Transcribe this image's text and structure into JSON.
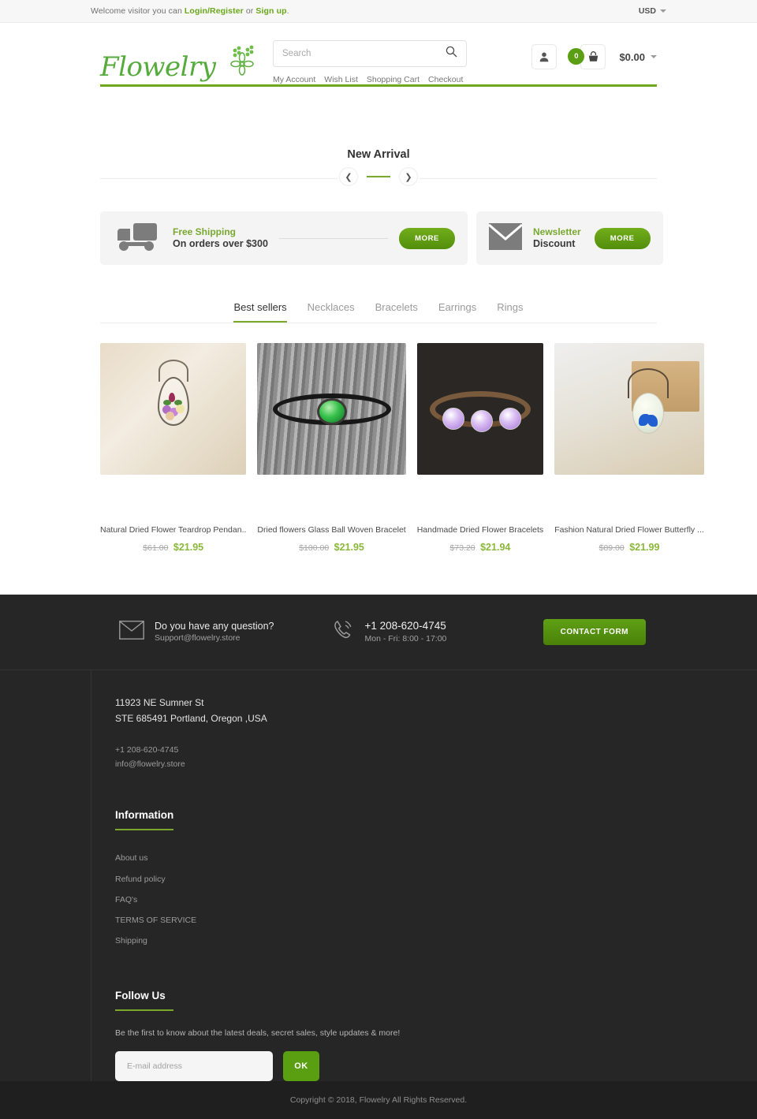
{
  "topbar": {
    "welcome_prefix": "Welcome visitor you can ",
    "login_label": "Login/Register",
    "or_label": " or ",
    "signup_label": "Sign up",
    "period": ".",
    "currency": "USD"
  },
  "header": {
    "logo_text": "Flowelry",
    "search_placeholder": "Search",
    "search_value": "",
    "links": [
      {
        "label": "My Account"
      },
      {
        "label": "Wish List"
      },
      {
        "label": "Shopping Cart"
      },
      {
        "label": "Checkout"
      }
    ],
    "cart_count": "0",
    "cart_total": "$0.00"
  },
  "new_arrival": {
    "title": "New Arrival",
    "prev_icon": "chevron-left-icon",
    "next_icon": "chevron-right-icon"
  },
  "promos": [
    {
      "icon": "truck-icon",
      "title": "Free Shipping",
      "subtitle": "On orders over $300",
      "button": "MORE"
    },
    {
      "icon": "envelope-icon",
      "title": "Newsletter",
      "subtitle": "Discount",
      "button": "MORE"
    }
  ],
  "tabs": [
    {
      "label": "Best sellers",
      "active": true
    },
    {
      "label": "Necklaces",
      "active": false
    },
    {
      "label": "Bracelets",
      "active": false
    },
    {
      "label": "Earrings",
      "active": false
    },
    {
      "label": "Rings",
      "active": false
    }
  ],
  "products": [
    {
      "title": "Natural Dried Flower Teardrop Pendan..",
      "old_price": "$61.00",
      "new_price": "$21.95"
    },
    {
      "title": "Dried flowers Glass Ball Woven Bracelet",
      "old_price": "$100.00",
      "new_price": "$21.95"
    },
    {
      "title": "Handmade Dried Flower Bracelets",
      "old_price": "$73.20",
      "new_price": "$21.94"
    },
    {
      "title": "Fashion Natural Dried Flower Butterfly ...",
      "old_price": "$89.00",
      "new_price": "$21.99"
    }
  ],
  "contact": {
    "question": "Do you have any question?",
    "email": "Support@flowelry.store",
    "phone": "+1 208-620-4745",
    "hours": "Mon - Fri: 8:00 - 17:00",
    "button": "CONTACT FORM"
  },
  "footer": {
    "address_line1": "11923 NE Sumner St",
    "address_line2": "STE 685491 Portland, Oregon ,USA",
    "phone": "+1 208-620-4745",
    "email": "info@flowelry.store",
    "information_heading": "Information",
    "information_links": [
      {
        "label": "About us"
      },
      {
        "label": "Refund policy"
      },
      {
        "label": "FAQ's"
      },
      {
        "label": "TERMS OF SERVICE"
      },
      {
        "label": "Shipping"
      }
    ],
    "follow_heading": "Follow Us",
    "follow_desc": "Be the first to know about the latest deals, secret sales, style updates & more!",
    "email_placeholder": "E-mail address",
    "email_value": "",
    "ok_label": "OK"
  },
  "copyright": "Copyright © 2018, Flowelry All Rights Reserved.",
  "colors": {
    "accent_green": "#6fa71f",
    "price_green": "#8bb83a",
    "dark_bg": "#262626"
  }
}
